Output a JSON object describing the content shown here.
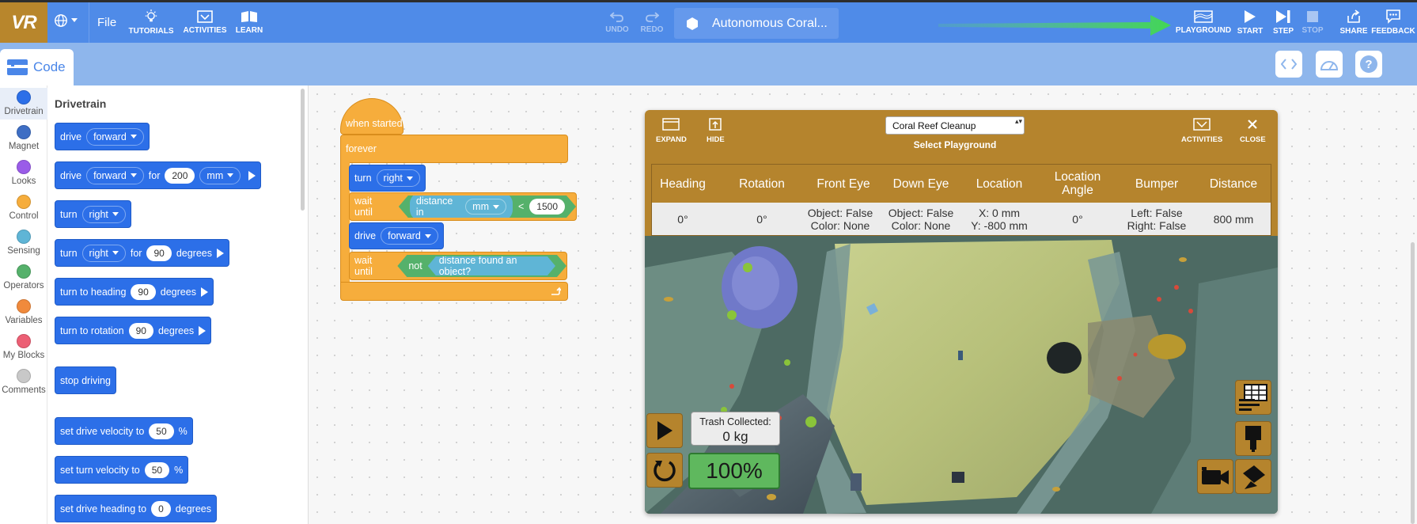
{
  "app": {
    "logo_text": "VR",
    "menu_file": "File"
  },
  "toolbar": {
    "tutorials": "TUTORIALS",
    "activities": "ACTIVITIES",
    "learn": "LEARN",
    "undo": "UNDO",
    "redo": "REDO",
    "project_name": "Autonomous Coral...",
    "playground": "PLAYGROUND",
    "start": "START",
    "step": "STEP",
    "stop": "STOP",
    "share": "SHARE",
    "feedback": "FEEDBACK"
  },
  "tabs": {
    "code": "Code"
  },
  "categories": [
    {
      "label": "Drivetrain",
      "color": "#2c6fe8"
    },
    {
      "label": "Magnet",
      "color": "#3e6ec4"
    },
    {
      "label": "Looks",
      "color": "#9a5ce8"
    },
    {
      "label": "Control",
      "color": "#f6ad3c"
    },
    {
      "label": "Sensing",
      "color": "#5fb5d6"
    },
    {
      "label": "Operators",
      "color": "#55b16b"
    },
    {
      "label": "Variables",
      "color": "#f08a3c"
    },
    {
      "label": "My Blocks",
      "color": "#ec5f74"
    },
    {
      "label": "Comments",
      "color": "#c8c8c8"
    }
  ],
  "flyout": {
    "title": "Drivetrain",
    "blocks": {
      "drive": "drive",
      "forward": "forward",
      "for": "for",
      "dist_value": "200",
      "mm": "mm",
      "turn": "turn",
      "right": "right",
      "turn_value": "90",
      "degrees": "degrees",
      "turn_to_heading": "turn to heading",
      "heading_value": "90",
      "turn_to_rotation": "turn to rotation",
      "rotation_value": "90",
      "stop_driving": "stop driving",
      "set_drive_velocity": "set drive velocity to",
      "drive_velocity_value": "50",
      "set_turn_velocity": "set turn velocity to",
      "turn_velocity_value": "50",
      "percent": "%",
      "set_drive_heading": "set drive heading to",
      "drive_heading_value": "0"
    }
  },
  "script": {
    "when_started": "when started",
    "forever": "forever",
    "turn": "turn",
    "right": "right",
    "wait_until": "wait until",
    "distance_in": "distance in",
    "mm": "mm",
    "lt": "<",
    "threshold": "1500",
    "drive": "drive",
    "forward": "forward",
    "not": "not",
    "distance_found": "distance found an object?"
  },
  "playground": {
    "expand": "EXPAND",
    "hide": "HIDE",
    "selected": "Coral Reef Cleanup",
    "select_label": "Select Playground",
    "activities": "ACTIVITIES",
    "close": "CLOSE",
    "headers": [
      "Heading",
      "Rotation",
      "Front Eye",
      "Down Eye",
      "Location",
      "Location Angle",
      "Bumper",
      "Distance"
    ],
    "values": [
      "0°",
      "0°",
      "Object: False\nColor: None",
      "Object: False\nColor: None",
      "X: 0 mm\nY: -800 mm",
      "0°",
      "Left: False\nRight: False",
      "800 mm"
    ],
    "trash_label": "Trash Collected:",
    "trash_value": "0 kg",
    "speed": "100%"
  }
}
